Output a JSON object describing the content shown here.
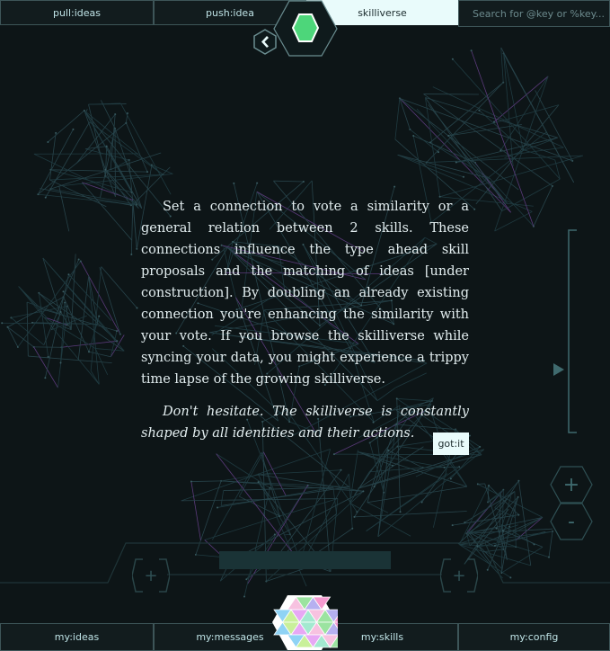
{
  "header": {
    "tabs": [
      {
        "label": "pull:ideas",
        "active": false
      },
      {
        "label": "push:idea",
        "active": false
      },
      {
        "label": "skilliverse",
        "active": true
      }
    ],
    "search_placeholder": "Search for @key or %key..."
  },
  "info": {
    "paragraph1": "Set a connection to vote a similarity or a general relation between 2 skills. These connections influence the type ahead skill proposals and the matching of ideas [under construction]. By doubling an already existing connection you're enhancing the similarity with your vote. If you browse the skilliverse while syncing your data, you might experience a trippy time lapse of the growing skilliverse.",
    "paragraph2": "Don't hesitate. The skilliverse is constantly shaped by all identities and their actions.",
    "button_label": "got:it"
  },
  "controls": {
    "zoom_in_label": "+",
    "zoom_out_label": "-",
    "timeline_left_label": "+",
    "timeline_right_label": "+"
  },
  "footer": {
    "tabs": [
      {
        "label": "my:ideas"
      },
      {
        "label": "my:messages"
      },
      {
        "label": "my:skills"
      },
      {
        "label": "my:config"
      }
    ]
  },
  "colors": {
    "background": "#0d1517",
    "accent_green": "#4dd67a",
    "active_tab": "#e9fbfb",
    "network_line": "#2e4a50"
  }
}
